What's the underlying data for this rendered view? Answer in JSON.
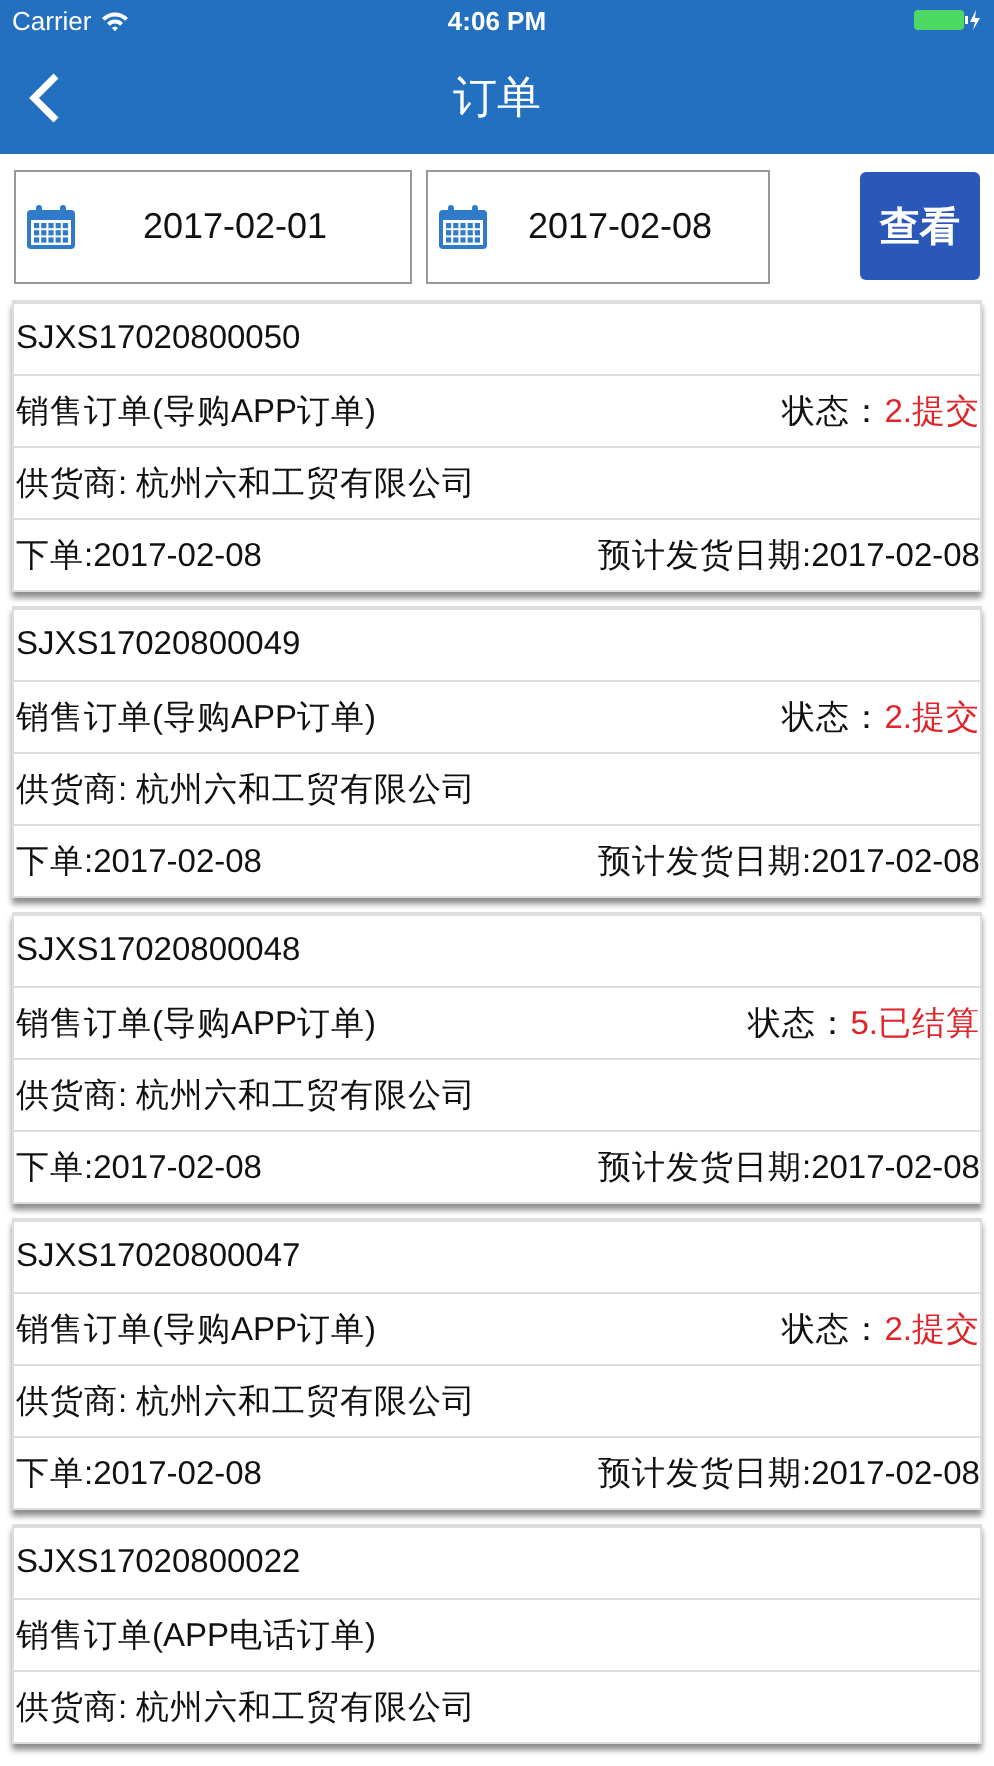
{
  "status_bar": {
    "carrier": "Carrier",
    "time": "4:06 PM"
  },
  "nav": {
    "title": "订单"
  },
  "filter": {
    "start_date": "2017-02-01",
    "end_date": "2017-02-08",
    "button": "查看"
  },
  "orders": [
    {
      "number": "SJXS17020800050",
      "type": "销售订单(导购APP订单)",
      "status_label": "状态：",
      "status": "2.提交",
      "supplier": "供货商: 杭州六和工贸有限公司",
      "order_date": "下单:2017-02-08",
      "ship_date": "预计发货日期:2017-02-08"
    },
    {
      "number": "SJXS17020800049",
      "type": "销售订单(导购APP订单)",
      "status_label": "状态：",
      "status": "2.提交",
      "supplier": "供货商: 杭州六和工贸有限公司",
      "order_date": "下单:2017-02-08",
      "ship_date": "预计发货日期:2017-02-08"
    },
    {
      "number": "SJXS17020800048",
      "type": "销售订单(导购APP订单)",
      "status_label": "状态：",
      "status": "5.已结算",
      "supplier": "供货商: 杭州六和工贸有限公司",
      "order_date": "下单:2017-02-08",
      "ship_date": "预计发货日期:2017-02-08"
    },
    {
      "number": "SJXS17020800047",
      "type": "销售订单(导购APP订单)",
      "status_label": "状态：",
      "status": "2.提交",
      "supplier": "供货商: 杭州六和工贸有限公司",
      "order_date": "下单:2017-02-08",
      "ship_date": "预计发货日期:2017-02-08"
    },
    {
      "number": "SJXS17020800022",
      "type": "销售订单(APP电话订单)",
      "supplier": "供货商: 杭州六和工贸有限公司"
    }
  ]
}
